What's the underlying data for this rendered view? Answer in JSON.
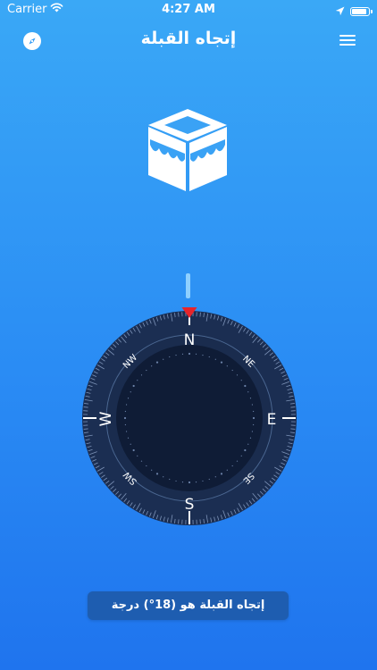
{
  "status_bar": {
    "carrier": "Carrier",
    "time": "4:27 AM",
    "battery_level": 0.95
  },
  "nav": {
    "title": "إتجاه القبلة",
    "left_icon": "compass-icon",
    "right_icon": "menu-icon"
  },
  "compass": {
    "cardinals": {
      "n": "N",
      "e": "E",
      "s": "S",
      "w": "W"
    },
    "intercardinals": {
      "ne": "NE",
      "se": "SE",
      "sw": "SW",
      "nw": "NW"
    },
    "needle_color": "#e8252b"
  },
  "qibla_label": "إتجاه القبلة هو (18°) درجة",
  "colors": {
    "bg_top": "#3aa8f6",
    "bg_bottom": "#1f74ee",
    "dial": "#1b2e52",
    "dial_inner": "#0f1c36"
  }
}
